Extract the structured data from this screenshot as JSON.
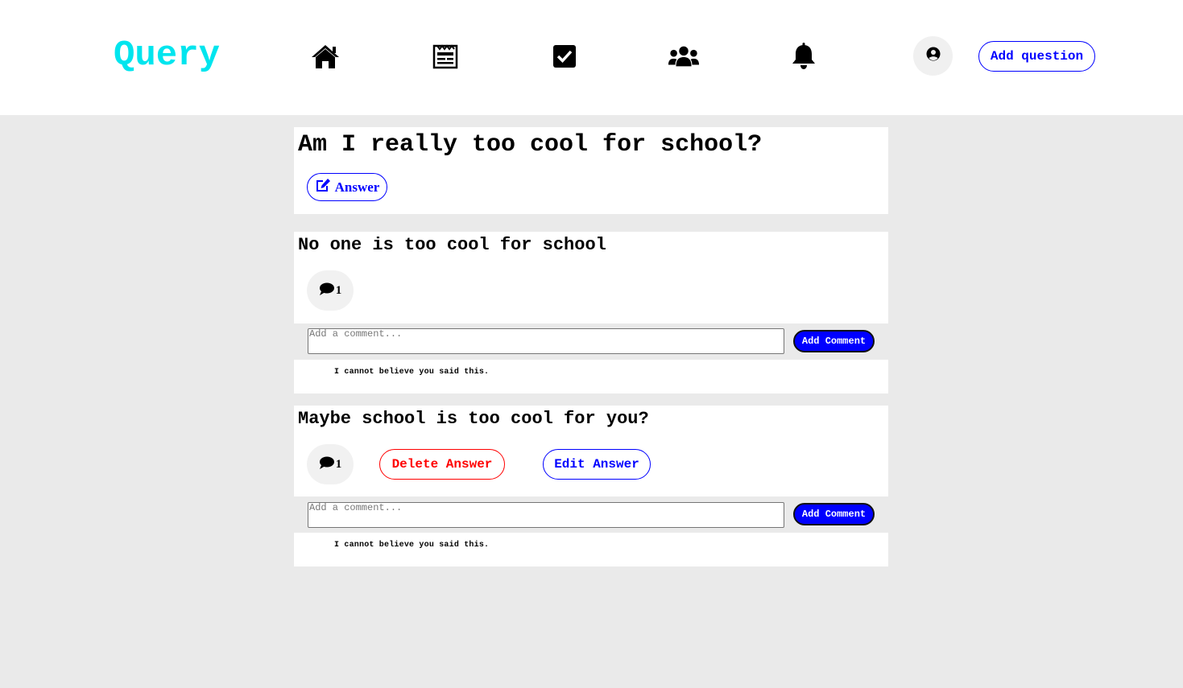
{
  "header": {
    "logo": "Query",
    "nav": [
      {
        "icon": "home-icon"
      },
      {
        "icon": "newspaper-icon"
      },
      {
        "icon": "check-square-icon"
      },
      {
        "icon": "users-icon"
      },
      {
        "icon": "bell-icon"
      }
    ],
    "avatar_icon": "user-circle-icon",
    "add_question_label": "Add question"
  },
  "question": {
    "title": "Am I really too cool for school?",
    "answer_button_label": "Answer",
    "answer_icon": "edit-icon"
  },
  "answers": [
    {
      "text": "No one is too cool for school",
      "comment_count": "1",
      "comment_placeholder": "Add a comment...",
      "add_comment_label": "Add Comment",
      "comments": [
        "I cannot believe you said this."
      ]
    },
    {
      "text": "Maybe school is too cool for you?",
      "comment_count": "1",
      "delete_label": "Delete Answer",
      "edit_label": "Edit Answer",
      "comment_placeholder": "Add a comment...",
      "add_comment_label": "Add Comment",
      "comments": [
        "I cannot believe you said this."
      ]
    }
  ],
  "colors": {
    "logo": "#00e5ee",
    "primary": "#0000ff",
    "danger": "#ff0000",
    "page_background": "#eaeaea"
  }
}
